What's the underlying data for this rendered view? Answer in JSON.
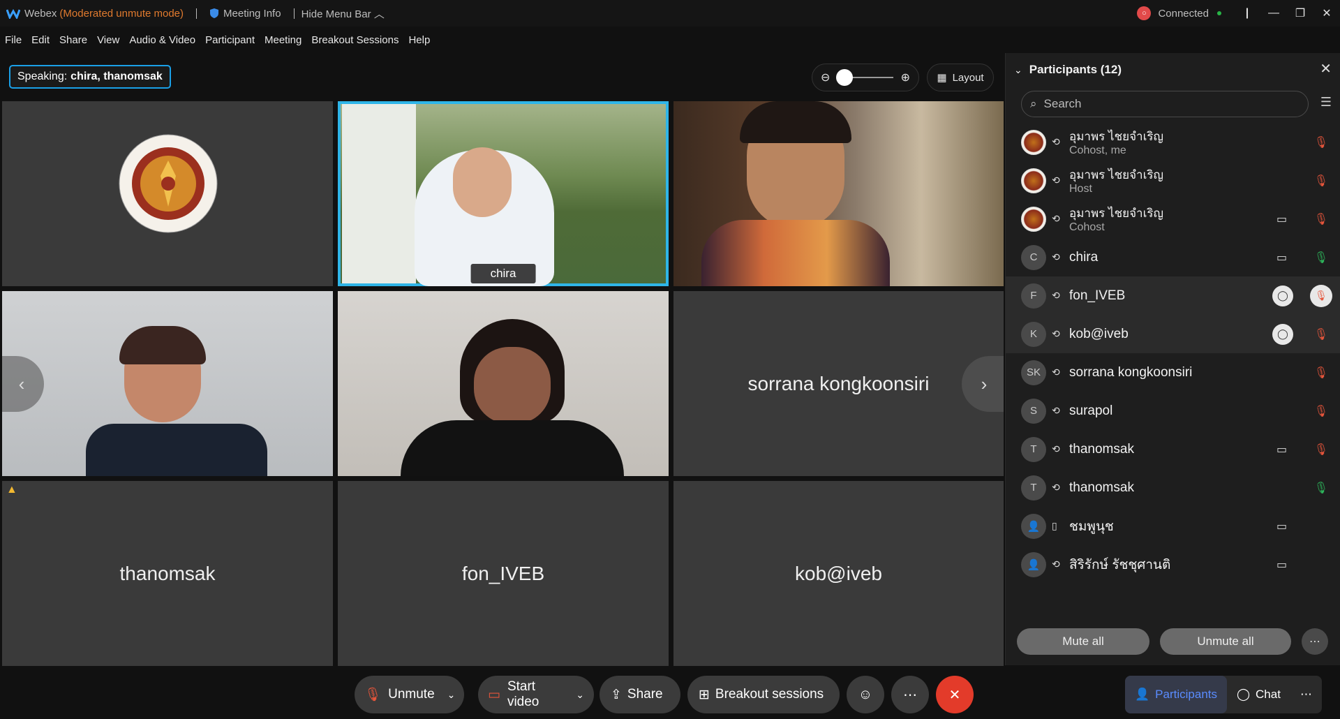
{
  "titlebar": {
    "app": "Webex",
    "mode": "(Moderated unmute mode)",
    "meeting_info": "Meeting Info",
    "hide_menu": "Hide Menu Bar",
    "connected": "Connected"
  },
  "menu": [
    "File",
    "Edit",
    "Share",
    "View",
    "Audio & Video",
    "Participant",
    "Meeting",
    "Breakout Sessions",
    "Help"
  ],
  "stage": {
    "speaking_label": "Speaking:",
    "speaking_names": "chira, thanomsak",
    "layout_label": "Layout",
    "tiles": [
      {
        "name": ""
      },
      {
        "name": "chira"
      },
      {
        "name": ""
      },
      {
        "name": ""
      },
      {
        "name": ""
      },
      {
        "name": "sorrana kongkoonsiri"
      },
      {
        "name": "thanomsak"
      },
      {
        "name": "fon_IVEB"
      },
      {
        "name": "kob@iveb"
      }
    ]
  },
  "toolbar": {
    "unmute": "Unmute",
    "start_video": "Start video",
    "share": "Share",
    "breakout": "Breakout sessions"
  },
  "panel": {
    "title": "Participants (12)",
    "search_placeholder": "Search",
    "participants": [
      {
        "name": "อุมาพร ไชยจำเริญ",
        "role": "Cohost, me",
        "initials": "",
        "video": false,
        "mic": "muted"
      },
      {
        "name": "อุมาพร ไชยจำเริญ",
        "role": "Host",
        "initials": "",
        "video": false,
        "mic": "muted"
      },
      {
        "name": "อุมาพร ไชยจำเริญ",
        "role": "Cohost",
        "initials": "",
        "video": true,
        "mic": "muted"
      },
      {
        "name": "chira",
        "role": "",
        "initials": "C",
        "video": true,
        "mic": "live"
      },
      {
        "name": "fon_IVEB",
        "role": "",
        "initials": "F",
        "video": false,
        "mic": "muted"
      },
      {
        "name": "kob@iveb",
        "role": "",
        "initials": "K",
        "video": false,
        "mic": "muted"
      },
      {
        "name": "sorrana kongkoonsiri",
        "role": "",
        "initials": "SK",
        "video": false,
        "mic": "muted"
      },
      {
        "name": "surapol",
        "role": "",
        "initials": "S",
        "video": false,
        "mic": "muted"
      },
      {
        "name": "thanomsak",
        "role": "",
        "initials": "T",
        "video": true,
        "mic": "muted"
      },
      {
        "name": "thanomsak",
        "role": "",
        "initials": "T",
        "video": false,
        "mic": "live"
      },
      {
        "name": "ชมพูนุช",
        "role": "",
        "initials": "",
        "video": true,
        "mic": "none"
      },
      {
        "name": "สิริรักษ์ รัชชุศานติ",
        "role": "",
        "initials": "",
        "video": true,
        "mic": "none"
      }
    ],
    "mute_all": "Mute all",
    "unmute_all": "Unmute all"
  },
  "bottom_right": {
    "participants": "Participants",
    "chat": "Chat"
  }
}
